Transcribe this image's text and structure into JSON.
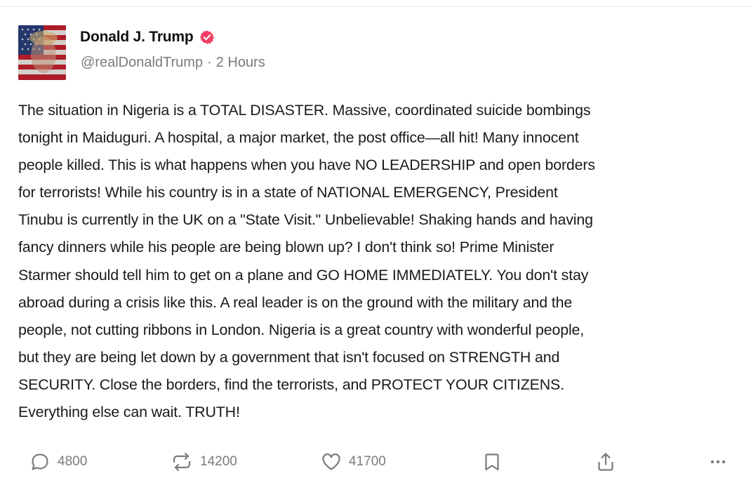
{
  "post": {
    "author": {
      "name": "Donald J. Trump",
      "handle": "@realDonaldTrump",
      "separator": "·",
      "timestamp": "2 Hours",
      "verified_badge_icon": "verified-check-icon",
      "verified_color": "#f23f63"
    },
    "body": "The situation in Nigeria is a TOTAL DISASTER. Massive, coordinated suicide bombings\ntonight in Maiduguri. A hospital, a major market, the post office—all hit! Many innocent\npeople killed. This is what happens when you have NO LEADERSHIP and open borders\nfor terrorists! While his country is in a state of NATIONAL EMERGENCY, President\nTinubu is currently in the UK on a \"State Visit.\" Unbelievable! Shaking hands and having\nfancy dinners while his people are being blown up? I don't think so! Prime Minister\nStarmer should tell him to get on a plane and GO HOME IMMEDIATELY. You don't stay\nabroad during a crisis like this. A real leader is on the ground with the military and the\npeople, not cutting ribbons in London. Nigeria is a great country with wonderful people,\nbut they are being let down by a government that isn't focused on STRENGTH and\nSECURITY. Close the borders, find the terrorists, and PROTECT YOUR CITIZENS.\nEverything else can wait. TRUTH!",
    "actions": {
      "replies": {
        "icon": "reply-bubble-icon",
        "count": "4800"
      },
      "retruths": {
        "icon": "retruth-arrows-icon",
        "count": "14200"
      },
      "likes": {
        "icon": "heart-icon",
        "count": "41700"
      },
      "bookmark": {
        "icon": "bookmark-icon"
      },
      "share": {
        "icon": "share-upload-icon"
      },
      "more": {
        "icon": "more-dots-icon"
      }
    }
  },
  "colors": {
    "text_primary": "#111111",
    "text_secondary": "#7a7a80",
    "divider": "#e8e8ea"
  }
}
